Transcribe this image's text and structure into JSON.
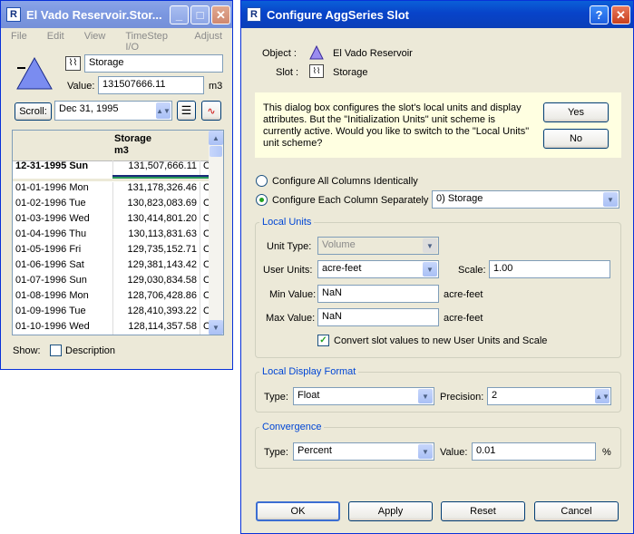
{
  "left_window": {
    "title": "El Vado Reservoir.Stor...",
    "menu": [
      "File",
      "Edit",
      "View",
      "TimeStep I/O",
      "Adjust"
    ],
    "slot_name": "Storage",
    "value_label": "Value:",
    "value": "131507666.11",
    "unit": "m3",
    "scroll_label": "Scroll:",
    "scroll_date": "Dec 31, 1995",
    "column_header": "Storage",
    "column_unit": "m3",
    "init_row": {
      "date": "12-31-1995 Sun",
      "value": "131,507,666.11",
      "flag": "O"
    },
    "rows": [
      {
        "date": "01-01-1996 Mon",
        "value": "131,178,326.46",
        "flag": "O"
      },
      {
        "date": "01-02-1996 Tue",
        "value": "130,823,083.69",
        "flag": "O"
      },
      {
        "date": "01-03-1996 Wed",
        "value": "130,414,801.20",
        "flag": "O"
      },
      {
        "date": "01-04-1996 Thu",
        "value": "130,113,831.63",
        "flag": "O"
      },
      {
        "date": "01-05-1996 Fri",
        "value": "129,735,152.71",
        "flag": "O"
      },
      {
        "date": "01-06-1996 Sat",
        "value": "129,381,143.42",
        "flag": "O"
      },
      {
        "date": "01-07-1996 Sun",
        "value": "129,030,834.58",
        "flag": "O"
      },
      {
        "date": "01-08-1996 Mon",
        "value": "128,706,428.86",
        "flag": "O"
      },
      {
        "date": "01-09-1996 Tue",
        "value": "128,410,393.22",
        "flag": "O"
      },
      {
        "date": "01-10-1996 Wed",
        "value": "128,114,357.58",
        "flag": "O"
      }
    ],
    "show_label": "Show:",
    "description_label": "Description"
  },
  "dialog": {
    "title": "Configure AggSeries Slot",
    "object_label": "Object :",
    "object_value": "El Vado Reservoir",
    "slot_label": "Slot :",
    "slot_value": "Storage",
    "message": "This dialog box configures the slot's local units and display attributes. But the \"Initialization Units\" unit scheme is currently active. Would you like to switch to the \"Local Units\" unit scheme?",
    "yes": "Yes",
    "no": "No",
    "radio_all": "Configure All Columns Identically",
    "radio_each": "Configure Each Column Separately",
    "column_select": "0)  Storage",
    "local_units": {
      "title": "Local Units",
      "unit_type_label": "Unit Type:",
      "unit_type": "Volume",
      "user_units_label": "User Units:",
      "user_units": "acre-feet",
      "scale_label": "Scale:",
      "scale": "1.00",
      "min_label": "Min Value:",
      "min": "NaN",
      "min_unit": "acre-feet",
      "max_label": "Max Value:",
      "max": "NaN",
      "max_unit": "acre-feet",
      "convert_label": "Convert slot values to new User Units and Scale"
    },
    "display_format": {
      "title": "Local Display Format",
      "type_label": "Type:",
      "type": "Float",
      "precision_label": "Precision:",
      "precision": "2"
    },
    "convergence": {
      "title": "Convergence",
      "type_label": "Type:",
      "type": "Percent",
      "value_label": "Value:",
      "value": "0.01",
      "unit": "%"
    },
    "buttons": {
      "ok": "OK",
      "apply": "Apply",
      "reset": "Reset",
      "cancel": "Cancel"
    }
  }
}
